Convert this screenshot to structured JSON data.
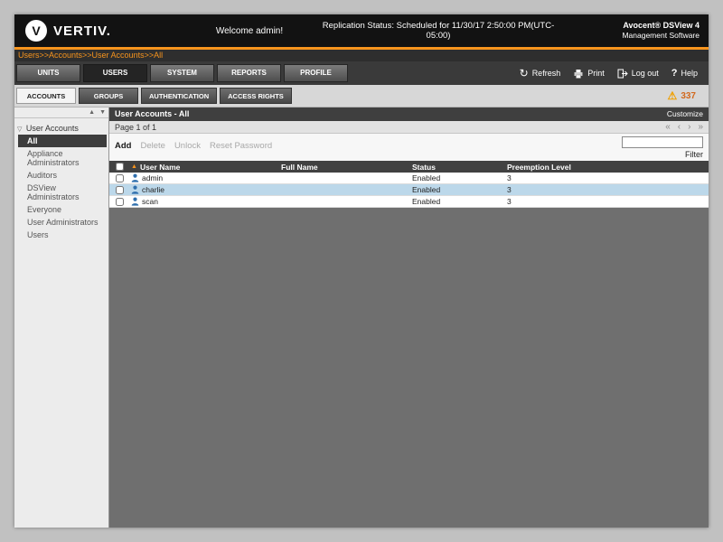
{
  "header": {
    "brand": "VERTIV.",
    "brand_initial": "V",
    "welcome": "Welcome admin!",
    "replication_status": "Replication Status: Scheduled for 11/30/17 2:50:00 PM(UTC-05:00)",
    "product_title": "Avocent® DSView 4",
    "product_subtitle": "Management Software"
  },
  "breadcrumb": {
    "path": "Users>>Accounts>>User Accounts>>All"
  },
  "nav": {
    "tabs": [
      {
        "label": "UNITS"
      },
      {
        "label": "USERS"
      },
      {
        "label": "SYSTEM"
      },
      {
        "label": "REPORTS"
      },
      {
        "label": "PROFILE"
      }
    ],
    "actions": {
      "refresh": "Refresh",
      "print": "Print",
      "logout": "Log out",
      "help": "Help"
    }
  },
  "subnav": {
    "tabs": [
      {
        "label": "ACCOUNTS"
      },
      {
        "label": "GROUPS"
      },
      {
        "label": "AUTHENTICATION"
      },
      {
        "label": "ACCESS RIGHTS"
      }
    ],
    "alert_count": "337"
  },
  "sidebar": {
    "root_label": "User Accounts",
    "items": [
      {
        "label": "All"
      },
      {
        "label": "Appliance Administrators"
      },
      {
        "label": "Auditors"
      },
      {
        "label": "DSView Administrators"
      },
      {
        "label": "Everyone"
      },
      {
        "label": "User Administrators"
      },
      {
        "label": "Users"
      }
    ]
  },
  "main": {
    "title": "User Accounts - All",
    "customize_label": "Customize",
    "page_info": "Page 1 of 1",
    "toolbar": {
      "add": "Add",
      "delete": "Delete",
      "unlock": "Unlock",
      "reset": "Reset Password"
    },
    "filter": {
      "value": "",
      "label": "Filter"
    },
    "table": {
      "headers": {
        "user": "User Name",
        "full_name": "Full Name",
        "status": "Status",
        "preemption": "Preemption Level"
      },
      "rows": [
        {
          "user": "admin",
          "full_name": "",
          "status": "Enabled",
          "preemption": "3"
        },
        {
          "user": "charlie",
          "full_name": "",
          "status": "Enabled",
          "preemption": "3"
        },
        {
          "user": "scan",
          "full_name": "",
          "status": "Enabled",
          "preemption": "3"
        }
      ]
    }
  },
  "icons": {
    "refresh": "↻",
    "help": "?",
    "warning": "⚠",
    "sort_asc": "▲",
    "scroll_up": "▲",
    "scroll_down": "▼",
    "tree_expander": "▽",
    "page_first": "«",
    "page_prev": "‹",
    "page_next": "›",
    "page_last": "»"
  },
  "colors": {
    "accent": "#f7941d",
    "selected_row": "#bcd8ea"
  }
}
